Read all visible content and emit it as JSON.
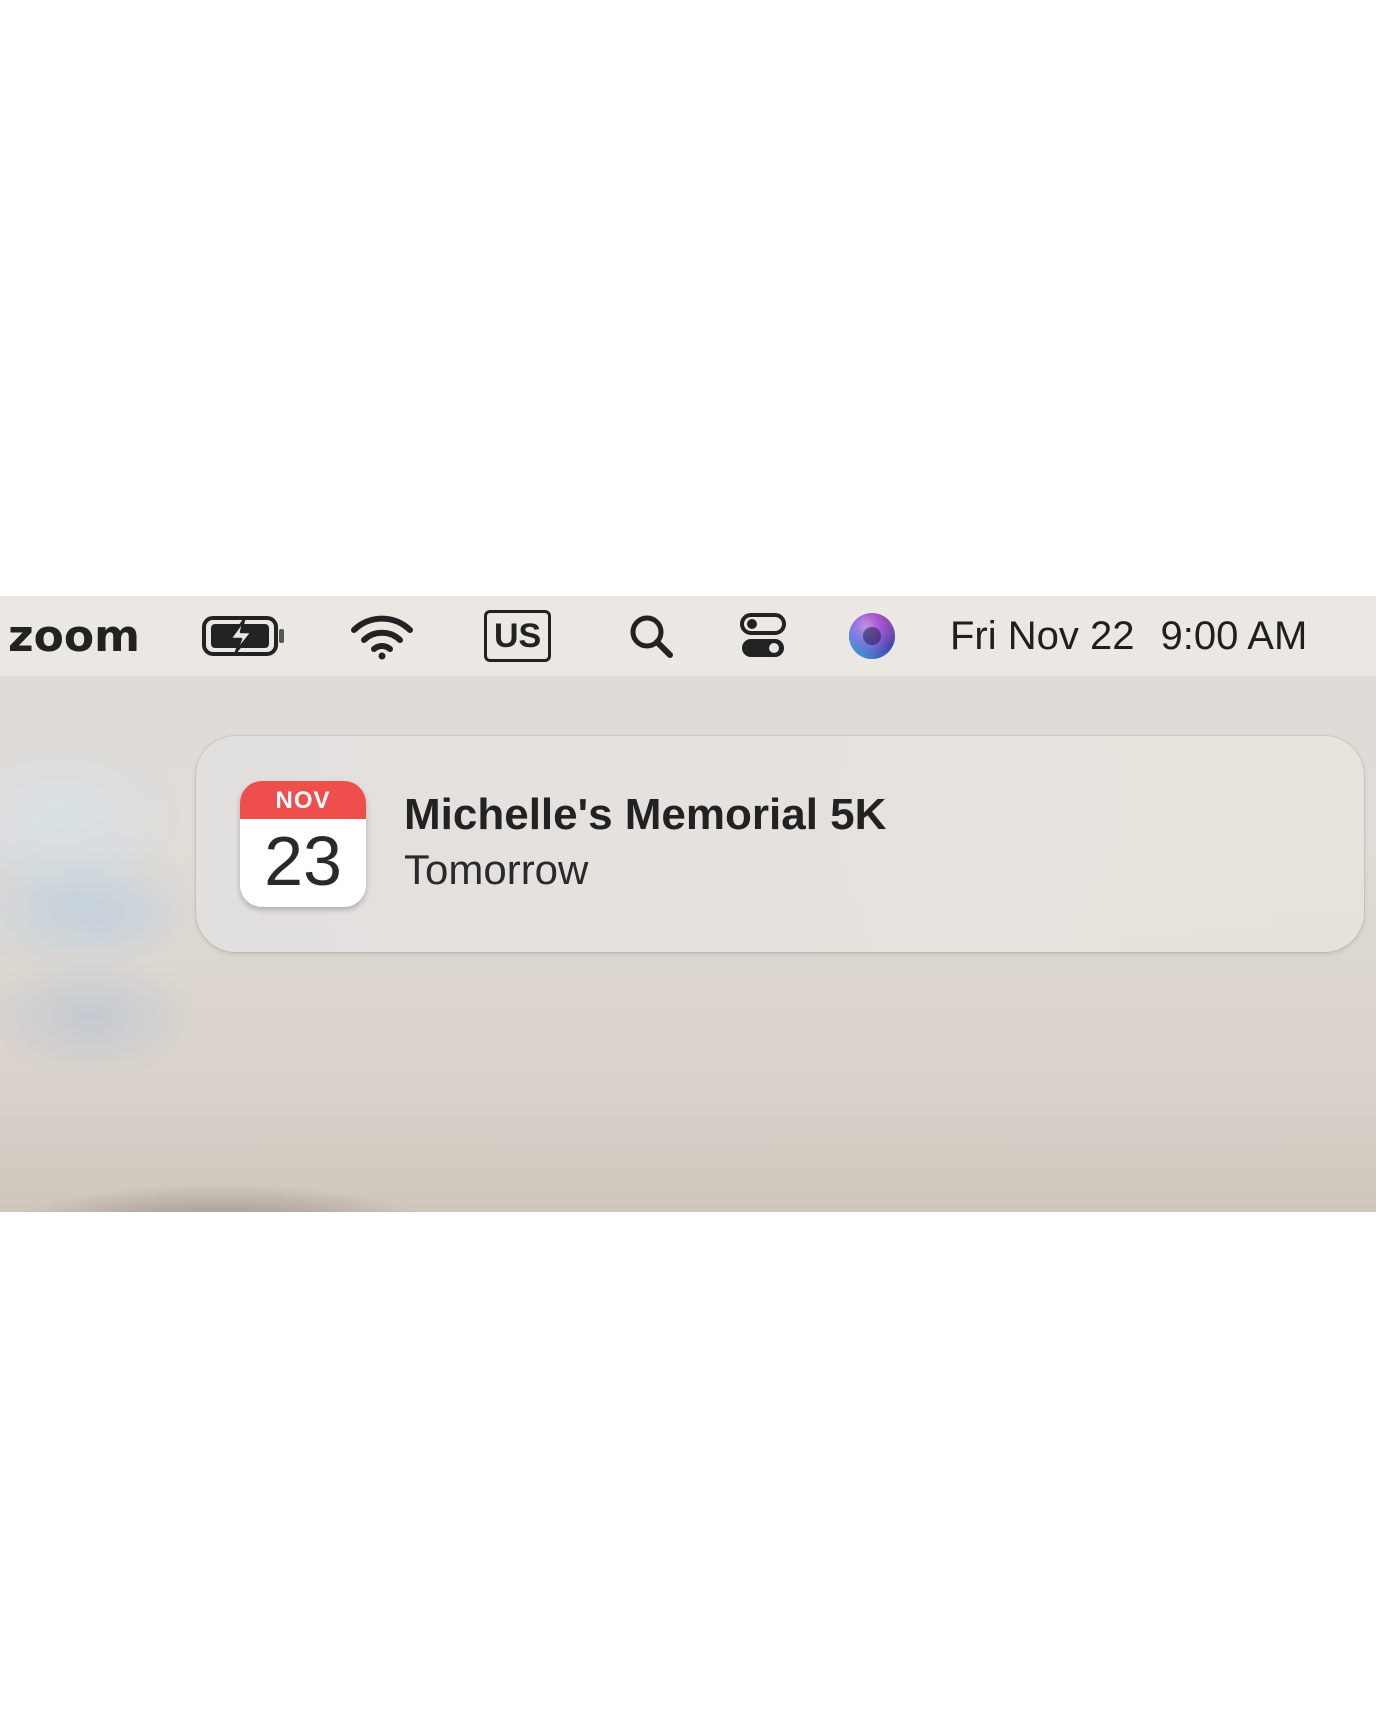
{
  "menubar": {
    "app_name": "zoom",
    "input_source": "US",
    "date": "Fri Nov 22",
    "time": "9:00 AM",
    "icons": [
      "battery-charging-icon",
      "wifi-icon",
      "search-icon",
      "control-center-icon",
      "siri-icon"
    ]
  },
  "notification": {
    "app": "Calendar",
    "icon_month": "NOV",
    "icon_day": "23",
    "title": "Michelle's Memorial 5K",
    "subtitle": "Tomorrow"
  },
  "colors": {
    "menubar_bg": "#ebe8e4",
    "calendar_red": "#ee4e4c",
    "text_dark": "#222222"
  }
}
